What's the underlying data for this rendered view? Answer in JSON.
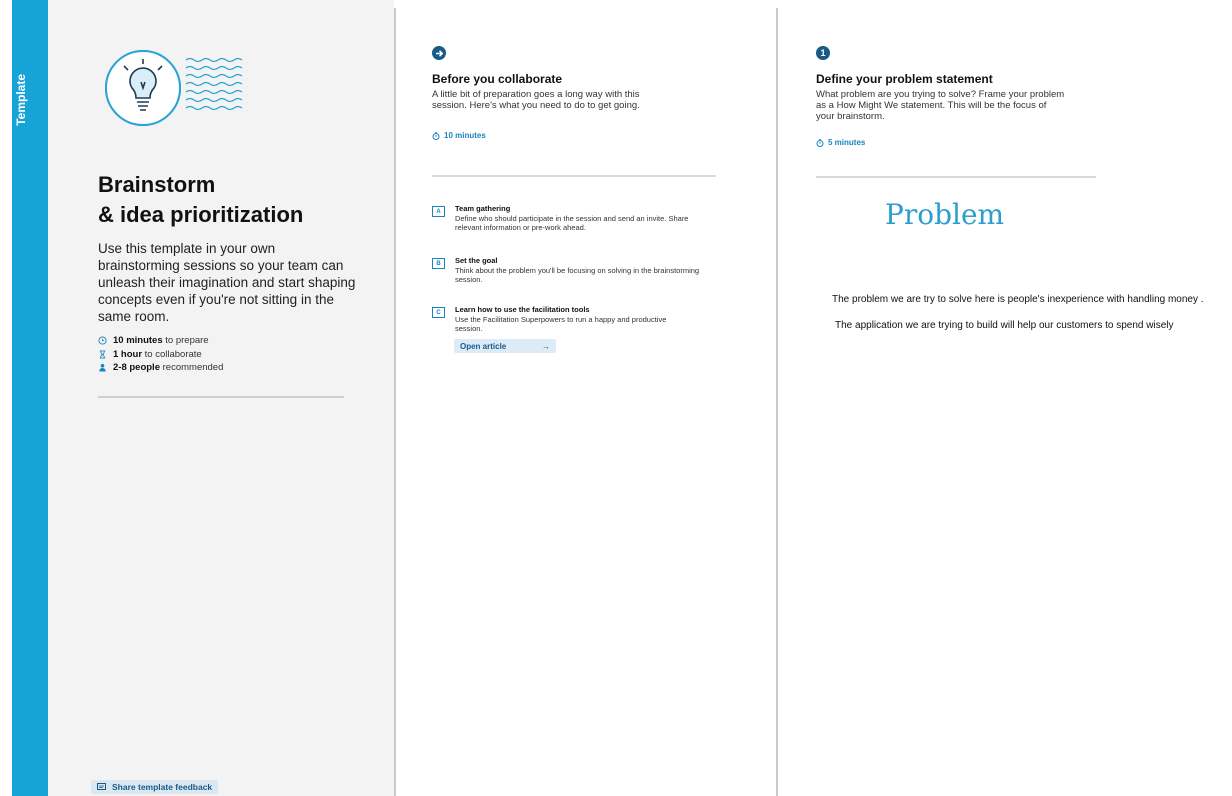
{
  "side_label": "Template",
  "intro": {
    "title_line1": "Brainstorm",
    "title_line2": "& idea prioritization",
    "description": "Use this template in your own brainstorming sessions so your team can unleash their imagination and start shaping concepts even if you're not sitting in the same room.",
    "meta": [
      {
        "icon": "clock-icon",
        "bold": "10 minutes",
        "text": " to prepare"
      },
      {
        "icon": "hourglass-icon",
        "bold": "1 hour",
        "text": " to collaborate"
      },
      {
        "icon": "person-icon",
        "bold": "2-8 people",
        "text": " recommended"
      }
    ],
    "feedback_label": "Share template feedback"
  },
  "before": {
    "badge_icon": "arrow-right-icon",
    "title": "Before you collaborate",
    "description": "A little bit of preparation goes a long way with this session. Here's what you need to do to get going.",
    "time": "10 minutes",
    "steps": [
      {
        "letter": "A",
        "title": "Team gathering",
        "desc": "Define who should participate in the session and send an invite. Share relevant information or pre-work ahead."
      },
      {
        "letter": "B",
        "title": "Set the goal",
        "desc": "Think about the problem you'll be focusing on solving in the brainstorming session."
      },
      {
        "letter": "C",
        "title": "Learn how to use the facilitation tools",
        "desc": "Use the Facilitation Superpowers to run a happy and productive session."
      }
    ],
    "open_article_label": "Open article"
  },
  "define": {
    "badge": "1",
    "title": "Define your problem statement",
    "description": "What problem are you trying to solve? Frame your problem as a How Might We statement. This will be the focus of your brainstorm.",
    "time": "5 minutes",
    "problem_heading": "Problem",
    "problem_line1": "The problem we are try to solve here is people's inexperience with handling money .",
    "problem_line2": "The application we are trying to build will help our customers to spend wisely"
  },
  "colors": {
    "accent": "#18a3d6",
    "badge": "#1a5a86",
    "link": "#1a84c0"
  }
}
